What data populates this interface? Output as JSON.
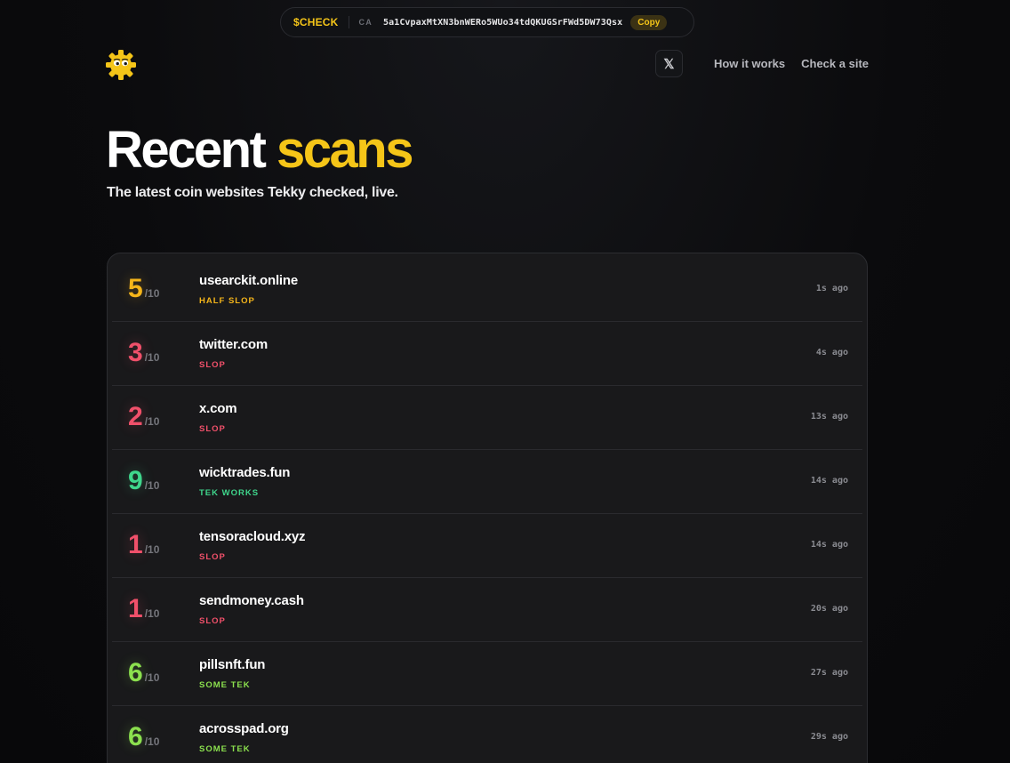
{
  "ca_bar": {
    "ticker": "$CHECK",
    "label": "CA",
    "address": "5a1CvpaxMtXN3bnWERo5WUo34tdQKUGSrFWd5DW73Qsx",
    "copy_label": "Copy"
  },
  "nav": {
    "x_icon": "x-logo-icon",
    "x_glyph": "𝕏",
    "how_it_works": "How it works",
    "check_a_site": "Check a site"
  },
  "hero": {
    "title_main": "Recent",
    "title_accent": "scans",
    "subtitle": "The latest coin websites Tekky checked, live."
  },
  "colors": {
    "accent": "#f5c518",
    "half_slop": "#f5b51a",
    "slop": "#f0506a",
    "tek_works": "#3fd68c",
    "some_tek": "#8be04e"
  },
  "scans": [
    {
      "score": "5",
      "denominator": "/10",
      "site": "usearckit.online",
      "verdict": "HALF SLOP",
      "ago": "1s ago",
      "color": "#f5b51a"
    },
    {
      "score": "3",
      "denominator": "/10",
      "site": "twitter.com",
      "verdict": "SLOP",
      "ago": "4s ago",
      "color": "#f0506a"
    },
    {
      "score": "2",
      "denominator": "/10",
      "site": "x.com",
      "verdict": "SLOP",
      "ago": "13s ago",
      "color": "#f0506a"
    },
    {
      "score": "9",
      "denominator": "/10",
      "site": "wicktrades.fun",
      "verdict": "TEK WORKS",
      "ago": "14s ago",
      "color": "#3fd68c"
    },
    {
      "score": "1",
      "denominator": "/10",
      "site": "tensoracloud.xyz",
      "verdict": "SLOP",
      "ago": "14s ago",
      "color": "#f0506a"
    },
    {
      "score": "1",
      "denominator": "/10",
      "site": "sendmoney.cash",
      "verdict": "SLOP",
      "ago": "20s ago",
      "color": "#f0506a"
    },
    {
      "score": "6",
      "denominator": "/10",
      "site": "pillsnft.fun",
      "verdict": "SOME TEK",
      "ago": "27s ago",
      "color": "#8be04e"
    },
    {
      "score": "6",
      "denominator": "/10",
      "site": "acrosspad.org",
      "verdict": "SOME TEK",
      "ago": "29s ago",
      "color": "#8be04e"
    }
  ]
}
